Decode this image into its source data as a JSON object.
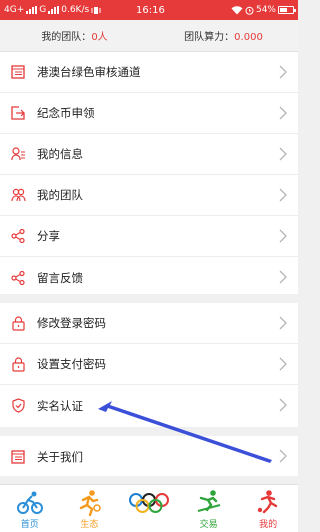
{
  "status_bar": {
    "network_left": "4G+",
    "network_right": "G",
    "speed": "0.6K/s",
    "time": "16:16",
    "battery": "54%"
  },
  "team_bar": {
    "my_team_label": "我的团队：",
    "my_team_value": "0人",
    "power_label": "团队算力：",
    "power_value": "0.000"
  },
  "menu": {
    "group1": [
      {
        "label": "港澳台绿色审核通道",
        "icon": "document-icon"
      },
      {
        "label": "纪念币申领",
        "icon": "export-icon"
      },
      {
        "label": "我的信息",
        "icon": "user-info-icon"
      },
      {
        "label": "我的团队",
        "icon": "team-icon"
      },
      {
        "label": "分享",
        "icon": "share-icon"
      },
      {
        "label": "留言反馈",
        "icon": "share-icon"
      }
    ],
    "group2": [
      {
        "label": "修改登录密码",
        "icon": "lock-icon"
      },
      {
        "label": "设置支付密码",
        "icon": "lock-icon"
      },
      {
        "label": "实名认证",
        "icon": "shield-icon"
      }
    ],
    "group3": [
      {
        "label": "关于我们",
        "icon": "document-icon"
      }
    ]
  },
  "bottom_nav": [
    {
      "label": "首页",
      "color": "#2a8fd8",
      "icon": "cyclist-icon"
    },
    {
      "label": "生态",
      "color": "#f39a1e",
      "icon": "runner-icon"
    },
    {
      "label": "",
      "color": "#333333",
      "icon": "olympic-rings-icon"
    },
    {
      "label": "交易",
      "color": "#2fa43a",
      "icon": "skier-icon"
    },
    {
      "label": "我的",
      "color": "#e63a3a",
      "icon": "soccer-player-icon"
    }
  ],
  "colors": {
    "brand_red": "#e63a3a",
    "annotation_arrow": "#3b4fd8"
  }
}
